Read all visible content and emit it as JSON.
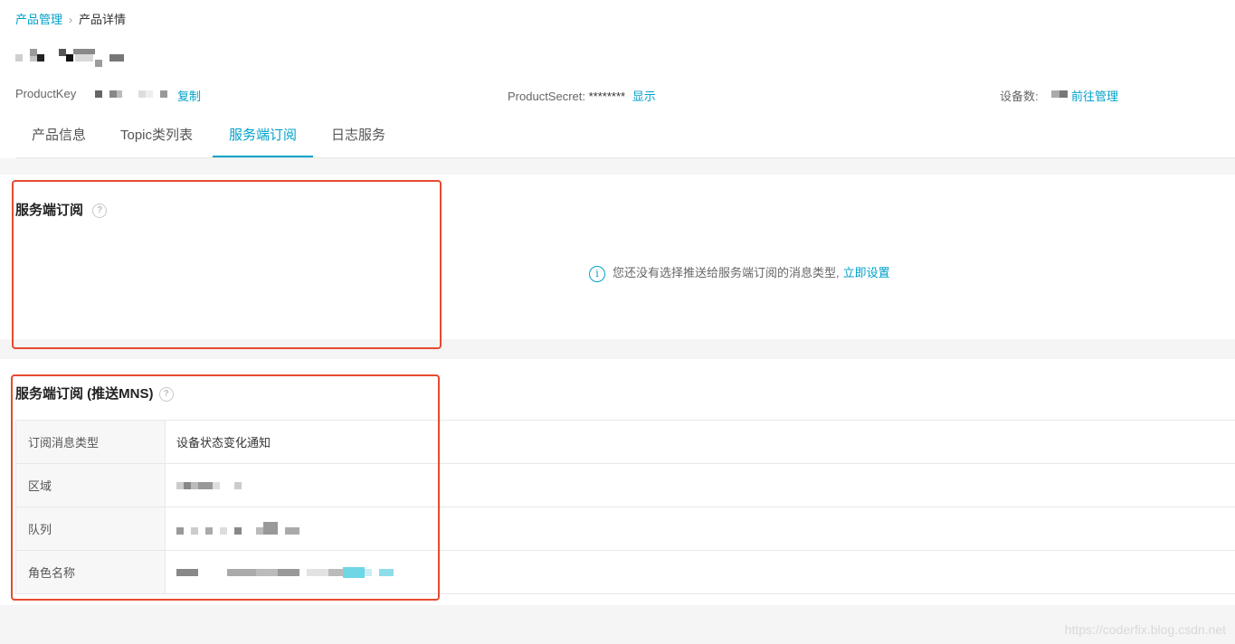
{
  "breadcrumb": {
    "parent": "产品管理",
    "separator": "›",
    "current": "产品详情"
  },
  "product_info": {
    "product_key_label": "ProductKey",
    "copy_label": "复制",
    "product_secret_label": "ProductSecret:",
    "product_secret_value": "********",
    "show_label": "显示",
    "device_count_label": "设备数:",
    "manage_label": "前往管理"
  },
  "tabs": [
    {
      "label": "产品信息",
      "active": false
    },
    {
      "label": "Topic类列表",
      "active": false
    },
    {
      "label": "服务端订阅",
      "active": true
    },
    {
      "label": "日志服务",
      "active": false
    }
  ],
  "server_subscription": {
    "title": "服务端订阅",
    "help_icon": "question-circle-icon",
    "notice_icon": "info-circle-icon",
    "notice_text": "您还没有选择推送给服务端订阅的消息类型,",
    "notice_link": "立即设置"
  },
  "mns_subscription": {
    "title": "服务端订阅 (推送MNS)",
    "help_icon": "question-circle-icon",
    "rows": [
      {
        "key": "订阅消息类型",
        "value": "设备状态变化通知"
      },
      {
        "key": "区域",
        "value": ""
      },
      {
        "key": "队列",
        "value": ""
      },
      {
        "key": "角色名称",
        "value": ""
      }
    ]
  },
  "watermark": "https://coderfix.blog.csdn.net",
  "colors": {
    "accent": "#00a2ca",
    "highlight_border": "#e8492f",
    "band": "#f5f5f6"
  }
}
